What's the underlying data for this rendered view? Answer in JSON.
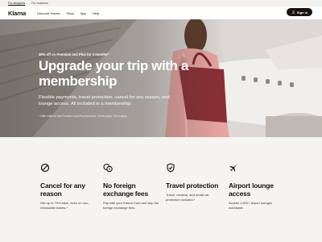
{
  "audience_bar": {
    "items": [
      "For shoppers",
      "For business"
    ]
  },
  "header": {
    "logo": "Klarna",
    "nav": [
      "Discover Klarna",
      "Shop",
      "App",
      "Help"
    ],
    "sign_in_label": "Sign in",
    "sign_in_icon": "user-icon"
  },
  "hero": {
    "eyebrow": "30% off on Premium and Plus for 3 months*",
    "title": "Upgrade your trip with a membership",
    "description": "Flexible payments, travel protection, cancel for any reason, and lounge access. All included in a membership.",
    "footnote": "* Offer valid for new Premium and Plus members. Terms apply. T&Cs apply."
  },
  "features": [
    {
      "icon": "cancel-icon",
      "title": "Cancel for any reason",
      "description": "Get up to 70% back, even on non-refundable tickets.*"
    },
    {
      "icon": "currency-icon",
      "title": "No foreign exchange fees",
      "description": "Pay with your Klarna Card and skip the foreign exchange fees."
    },
    {
      "icon": "shield-icon",
      "title": "Travel protection",
      "description": "Travel, medical, and rental car protection included.*"
    },
    {
      "icon": "airplane-icon",
      "title": "Airport lounge access",
      "description": "Access 1,800+ airport lounges worldwide."
    }
  ],
  "colors": {
    "text": "#17120f",
    "feature_bg": "#f6f4f0",
    "button_bg": "#17120f",
    "shirt_pink": "#e9a6a3",
    "bag_red": "#8a2f33"
  }
}
